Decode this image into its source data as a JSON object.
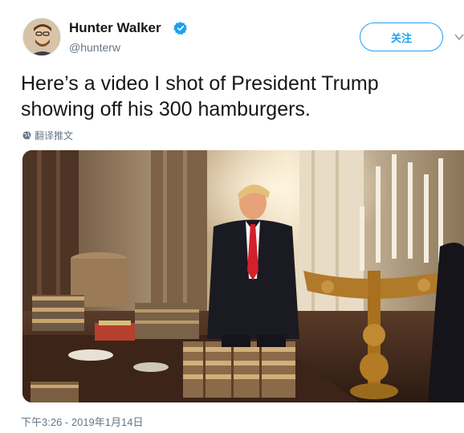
{
  "tweet": {
    "display_name": "Hunter Walker",
    "handle": "@hunterw",
    "verified": true,
    "follow_label": "关注",
    "text": "Here’s a video I shot of President Trump showing off his 300 hamburgers.",
    "translate_label": "翻译推文",
    "timestamp": "下午3:26 - 2019年1月14日",
    "media_alt": "video"
  },
  "colors": {
    "accent": "#1da1f2",
    "text": "#14171a",
    "secondary": "#657786"
  }
}
